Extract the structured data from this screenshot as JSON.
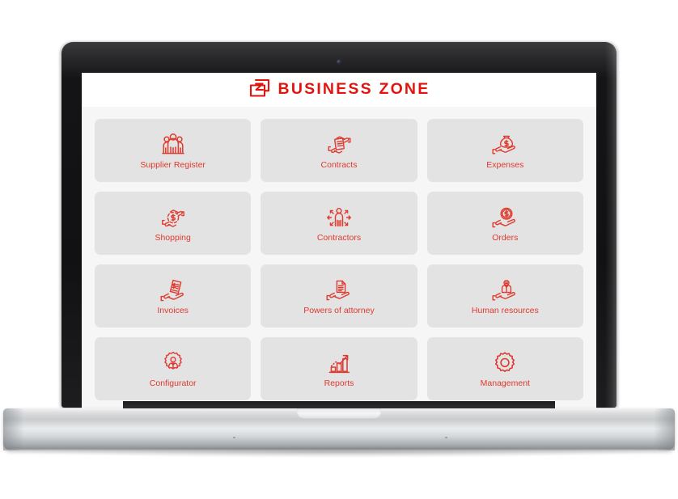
{
  "device": {
    "name": "laptop-mockup",
    "webcam": "webcam-dot"
  },
  "app": {
    "brand_name": "BUSINESS ZONE",
    "logo_icon": "business-zone-wallet-z-logo",
    "accent_color": "#e2140f",
    "label_color": "#e0392e",
    "tile_background": "#e3e3e3",
    "screen_background": "#f6f6f6",
    "header_background": "#ffffff"
  },
  "tiles": [
    {
      "label": "Supplier Register",
      "icon": "people-group-icon"
    },
    {
      "label": "Contracts",
      "icon": "hands-exchanging-document-icon"
    },
    {
      "label": "Expenses",
      "icon": "hand-holding-money-bag-icon"
    },
    {
      "label": "Shopping",
      "icon": "hands-exchanging-money-icon"
    },
    {
      "label": "Contractors",
      "icon": "person-with-arrows-icon"
    },
    {
      "label": "Orders",
      "icon": "hand-holding-dollar-coin-icon"
    },
    {
      "label": "Invoices",
      "icon": "hand-holding-invoice-icon"
    },
    {
      "label": "Powers of attorney",
      "icon": "hand-holding-document-icon"
    },
    {
      "label": "Human resources",
      "icon": "hand-holding-person-icon"
    },
    {
      "label": "Configurator",
      "icon": "gear-with-person-icon"
    },
    {
      "label": "Reports",
      "icon": "bar-chart-growth-arrow-icon"
    },
    {
      "label": "Management",
      "icon": "gear-icon"
    }
  ]
}
